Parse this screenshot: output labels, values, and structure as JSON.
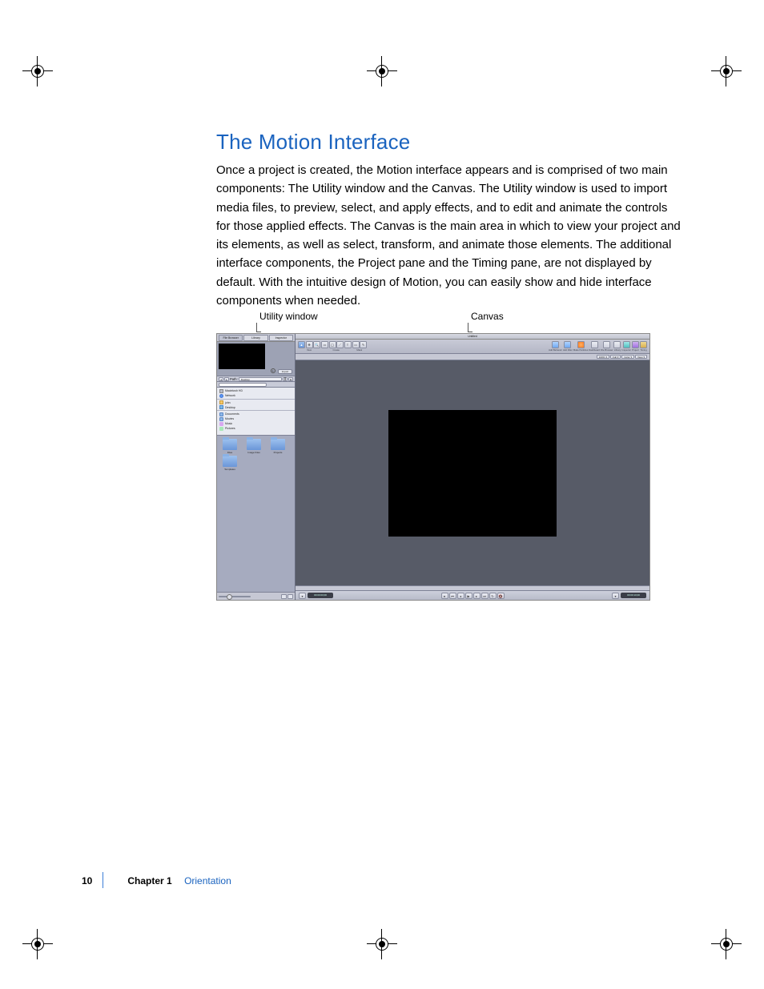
{
  "heading": "The Motion Interface",
  "body_text": "Once a project is created, the Motion interface appears and is comprised of two main components:  The Utility window and the Canvas. The Utility window is used to import media files, to preview, select, and apply effects, and to edit and animate the controls for those applied effects. The Canvas is the main area in which to view your project and its elements, as well as select, transform, and animate those elements. The additional interface components, the Project pane and the Timing pane, are not displayed by default. With the intuitive design of Motion, you can easily show and hide interface components when needed.",
  "callouts": {
    "utility": "Utility window",
    "canvas": "Canvas"
  },
  "utility_window": {
    "tabs": [
      "File Browser",
      "Library",
      "Inspector"
    ],
    "preview_import": "Import",
    "path_label": "Path:",
    "path_value": "Desktop",
    "file_list": [
      {
        "icon": "drive",
        "label": "Macintosh HD"
      },
      {
        "icon": "net",
        "label": "Network"
      },
      {
        "icon": "home",
        "label": "john"
      },
      {
        "icon": "desk",
        "label": "Desktop"
      },
      {
        "icon": "folder",
        "label": "Documents"
      },
      {
        "icon": "folder",
        "label": "Movies"
      },
      {
        "icon": "music",
        "label": "Music"
      },
      {
        "icon": "pic",
        "label": "Pictures"
      }
    ],
    "folders": [
      "Files",
      "Image Files",
      "Projects",
      "Templates"
    ]
  },
  "canvas_window": {
    "title": "Untitled",
    "left_tools": {
      "groups": [
        {
          "label": "View",
          "buttons": [
            "select",
            "pan",
            "zoom"
          ]
        },
        {
          "label": "Create",
          "buttons": [
            "rect",
            "circle",
            "line",
            "text"
          ]
        },
        {
          "label": "Mask",
          "buttons": [
            "mask-rect",
            "mask-bezier"
          ]
        }
      ]
    },
    "right_tools": {
      "groups": [
        {
          "label": "Add Behavior",
          "class": "blue"
        },
        {
          "label": "Add Filter",
          "class": "blue"
        },
        {
          "label": "Make Particles",
          "class": "orange"
        },
        {
          "label": "Dashboard",
          "class": ""
        },
        {
          "label": "File Browser",
          "class": ""
        },
        {
          "label": "Library",
          "class": ""
        },
        {
          "label": "Inspector",
          "class": "teal"
        },
        {
          "label": "Project",
          "class": "purple"
        },
        {
          "label": "Timing",
          "class": "gold"
        }
      ]
    },
    "zoom_bar": {
      "scale": "100%",
      "mode": "Full",
      "color": "Color",
      "view": "View"
    },
    "timecode_left": "00:00:00;00",
    "timecode_right": "00:00:10;00",
    "transport": [
      "record",
      "go-start",
      "step-back",
      "play",
      "step-fwd",
      "go-end",
      "loop",
      "mute"
    ]
  },
  "footer": {
    "page_number": "10",
    "chapter_label": "Chapter 1",
    "chapter_title": "Orientation"
  }
}
